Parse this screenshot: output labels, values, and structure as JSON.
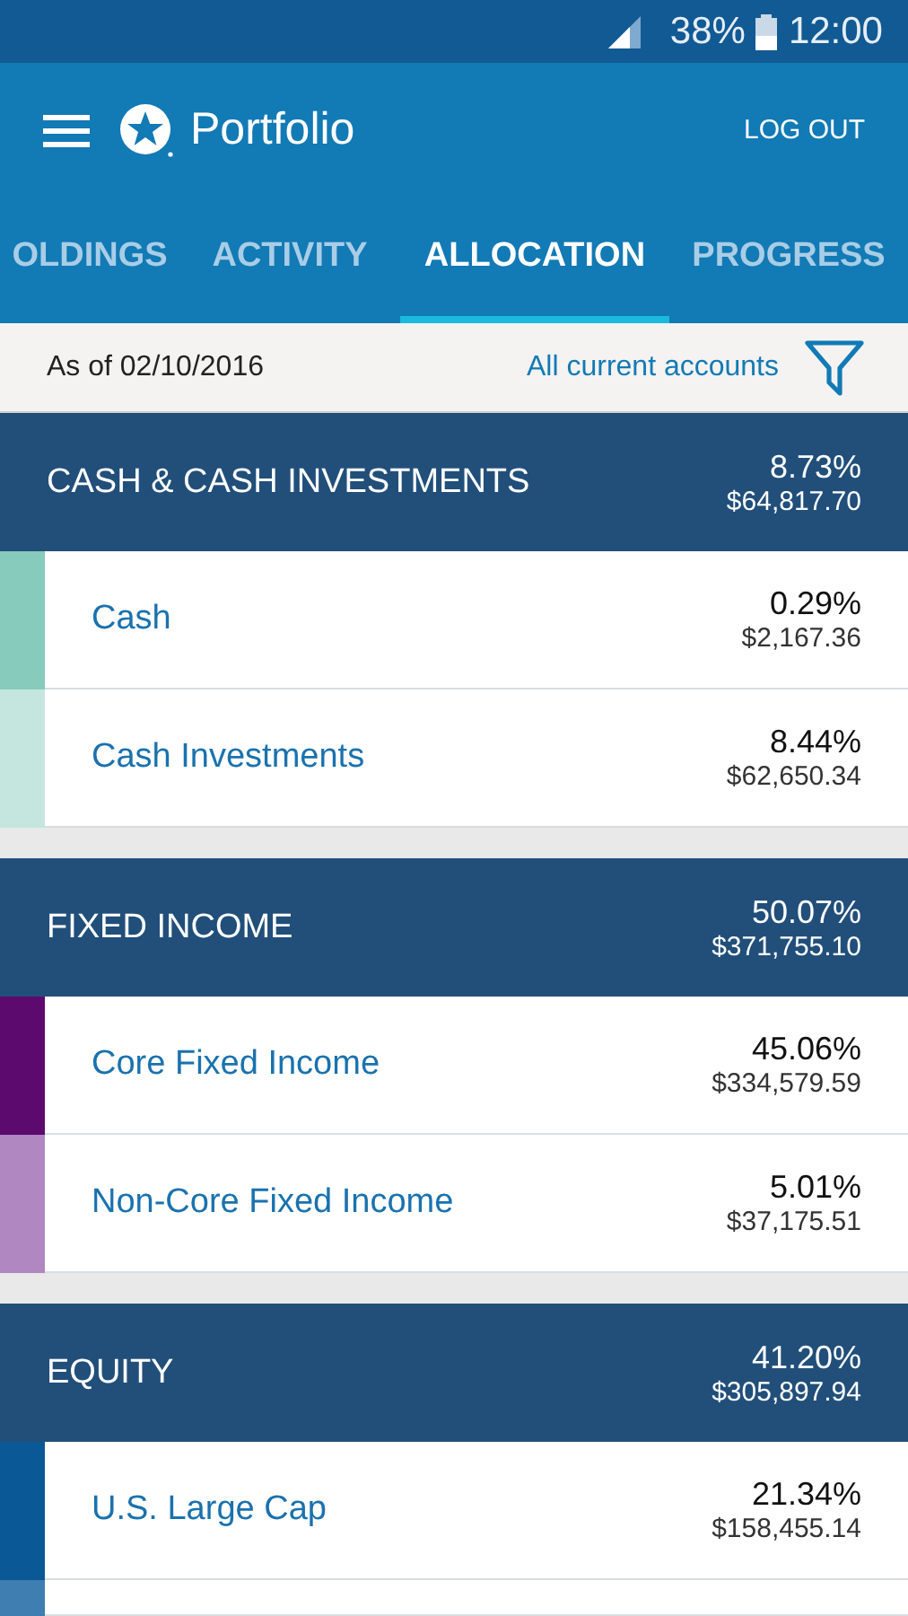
{
  "status_bar": {
    "battery": "38%",
    "time": "12:00"
  },
  "app_bar": {
    "title": "Portfolio",
    "action": "LOG OUT"
  },
  "tabs": [
    {
      "label": "OLDINGS",
      "selected": false
    },
    {
      "label": "ACTIVITY",
      "selected": false
    },
    {
      "label": "ALLOCATION",
      "selected": true
    },
    {
      "label": "PROGRESS",
      "selected": false
    }
  ],
  "filter_bar": {
    "date": "As of 02/10/2016",
    "accounts": "All current accounts"
  },
  "groups": [
    {
      "name": "CASH & CASH INVESTMENTS",
      "percent": "8.73%",
      "amount": "$64,817.70",
      "items": [
        {
          "name": "Cash",
          "percent": "0.29%",
          "amount": "$2,167.36",
          "color": "#86cbbb"
        },
        {
          "name": "Cash Investments",
          "percent": "8.44%",
          "amount": "$62,650.34",
          "color": "#c4e6de"
        }
      ]
    },
    {
      "name": "FIXED INCOME",
      "percent": "50.07%",
      "amount": "$371,755.10",
      "items": [
        {
          "name": "Core Fixed Income",
          "percent": "45.06%",
          "amount": "$334,579.59",
          "color": "#5c0a6e"
        },
        {
          "name": "Non-Core Fixed Income",
          "percent": "5.01%",
          "amount": "$37,175.51",
          "color": "#b087c0"
        }
      ]
    },
    {
      "name": "EQUITY",
      "percent": "41.20%",
      "amount": "$305,897.94",
      "items": [
        {
          "name": "U.S. Large Cap",
          "percent": "21.34%",
          "amount": "$158,455.14",
          "color": "#0b5897"
        },
        {
          "color": "#3e7eb0"
        }
      ]
    }
  ]
}
